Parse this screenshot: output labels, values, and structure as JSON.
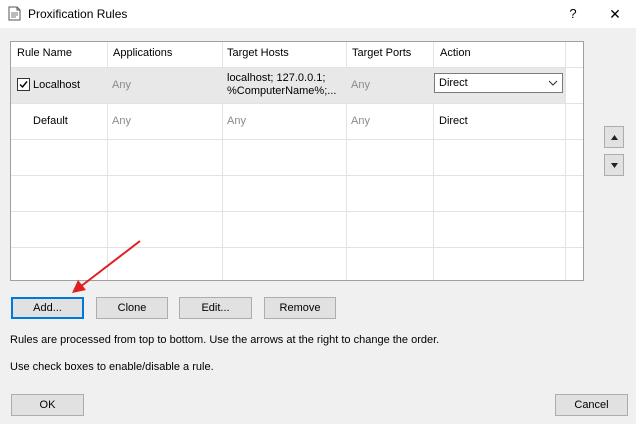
{
  "window": {
    "title": "Proxification Rules",
    "help_label": "?",
    "close_label": "✕"
  },
  "table": {
    "columns": [
      "Rule Name",
      "Applications",
      "Target Hosts",
      "Target Ports",
      "Action"
    ],
    "rows": [
      {
        "checked": true,
        "name": "Localhost",
        "applications": "Any",
        "target_hosts_line1": "localhost; 127.0.0.1;",
        "target_hosts_line2": "%ComputerName%;...",
        "target_ports": "Any",
        "action": "Direct"
      },
      {
        "name": "Default",
        "applications": "Any",
        "target_hosts": "Any",
        "target_ports": "Any",
        "action": "Direct"
      }
    ]
  },
  "side_buttons": {
    "up": "move-up",
    "down": "move-down"
  },
  "buttons": {
    "add": "Add...",
    "clone": "Clone",
    "edit": "Edit...",
    "remove": "Remove",
    "ok": "OK",
    "cancel": "Cancel"
  },
  "info": {
    "line1": "Rules are processed from top to bottom. Use the arrows at the right to change the order.",
    "line2": "Use check boxes to enable/disable a rule."
  },
  "colors": {
    "annotation_arrow": "#e02020",
    "selected_row": "#e8e8e8",
    "default_button_border": "#0078d7"
  }
}
